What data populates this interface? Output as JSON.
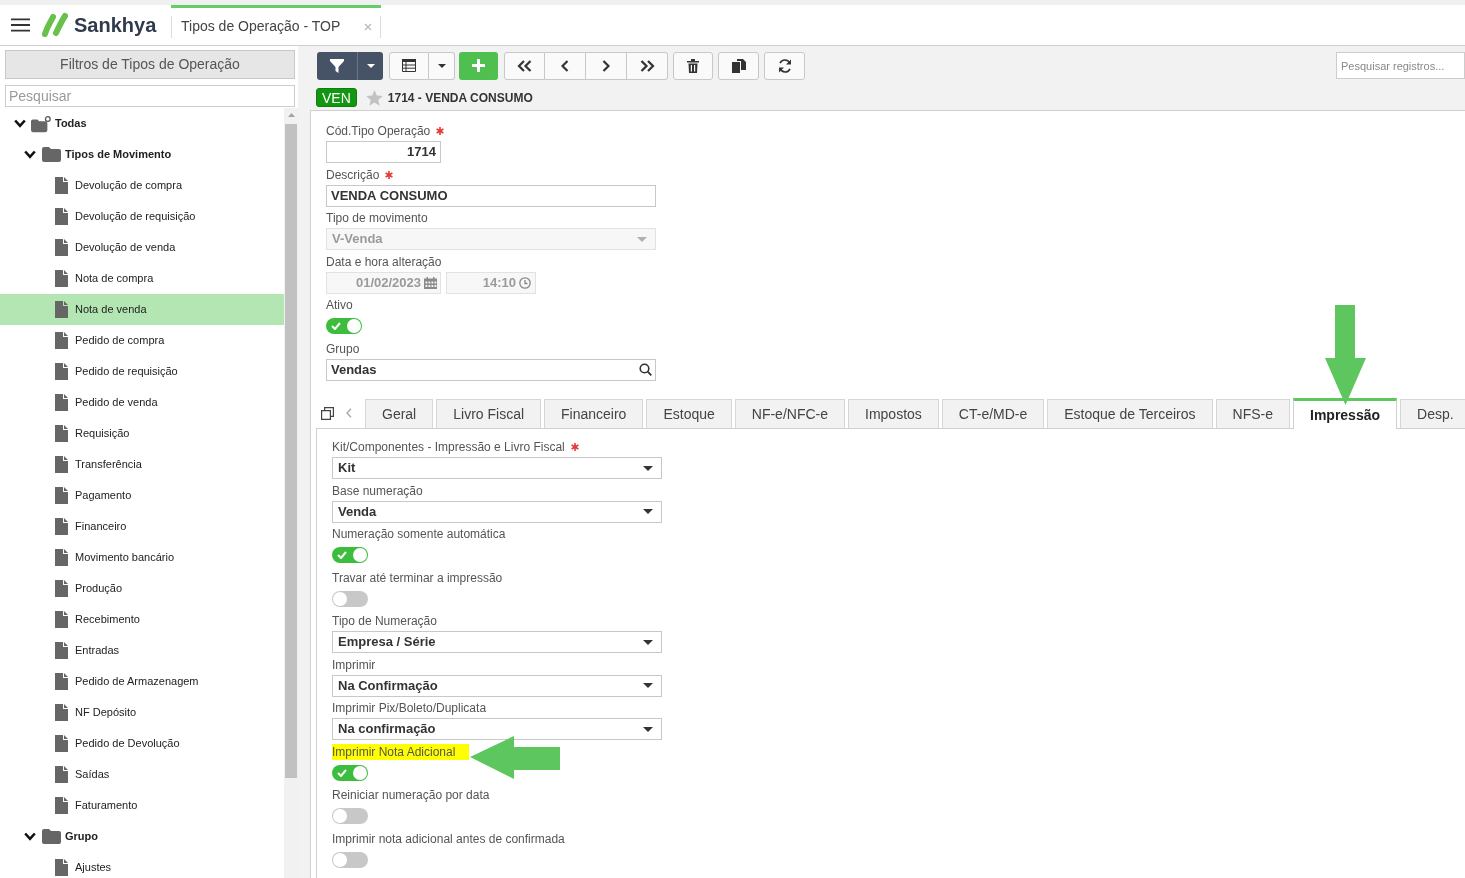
{
  "header": {
    "brand": "Sankhya",
    "tabs": [
      {
        "label": "Tipos de Operação - TOP",
        "selected": true
      }
    ]
  },
  "sidebar": {
    "filter_button": "Filtros de Tipos de Operação",
    "search": {
      "placeholder": "Pesquisar"
    },
    "tree": [
      {
        "label": "Todas",
        "kind": "root",
        "expanded": true,
        "selected": false,
        "children": [
          {
            "label": "Tipos de Movimento",
            "kind": "folder",
            "expanded": true,
            "selected": false,
            "children": [
              {
                "label": "Devolução de compra",
                "kind": "document",
                "selected": false
              },
              {
                "label": "Devolução de requisição",
                "kind": "document",
                "selected": false
              },
              {
                "label": "Devolução de venda",
                "kind": "document",
                "selected": false
              },
              {
                "label": "Nota de compra",
                "kind": "document",
                "selected": false
              },
              {
                "label": "Nota de venda",
                "kind": "document",
                "selected": true
              },
              {
                "label": "Pedido de compra",
                "kind": "document",
                "selected": false
              },
              {
                "label": "Pedido de requisição",
                "kind": "document",
                "selected": false
              },
              {
                "label": "Pedido de venda",
                "kind": "document",
                "selected": false
              },
              {
                "label": "Requisição",
                "kind": "document",
                "selected": false
              },
              {
                "label": "Transferência",
                "kind": "document",
                "selected": false
              },
              {
                "label": "Pagamento",
                "kind": "document",
                "selected": false
              },
              {
                "label": "Financeiro",
                "kind": "document",
                "selected": false
              },
              {
                "label": "Movimento bancário",
                "kind": "document",
                "selected": false
              },
              {
                "label": "Produção",
                "kind": "document",
                "selected": false
              },
              {
                "label": "Recebimento",
                "kind": "document",
                "selected": false
              },
              {
                "label": "Entradas",
                "kind": "document",
                "selected": false
              },
              {
                "label": "Pedido de Armazenagem",
                "kind": "document",
                "selected": false
              },
              {
                "label": "NF Depósito",
                "kind": "document",
                "selected": false
              },
              {
                "label": "Pedido de Devolução",
                "kind": "document",
                "selected": false
              },
              {
                "label": "Saídas",
                "kind": "document",
                "selected": false
              },
              {
                "label": "Faturamento",
                "kind": "document",
                "selected": false
              }
            ]
          },
          {
            "label": "Grupo",
            "kind": "folder",
            "expanded": true,
            "selected": false,
            "children": [
              {
                "label": "Ajustes",
                "kind": "document",
                "selected": false
              }
            ]
          }
        ]
      }
    ]
  },
  "toolbar": {
    "search": {
      "placeholder": "Pesquisar registros..."
    }
  },
  "record": {
    "badge": "VEN",
    "favorite": false,
    "title": "1714 - VENDA CONSUMO"
  },
  "form": {
    "fields": [
      {
        "kind": "number",
        "label": "Cód.Tipo Operação",
        "required": true,
        "disabled": false,
        "value": "1714"
      },
      {
        "kind": "text",
        "label": "Descrição",
        "required": true,
        "disabled": false,
        "value": "VENDA CONSUMO"
      },
      {
        "kind": "select",
        "label": "Tipo de movimento",
        "required": false,
        "disabled": true,
        "value": "V-Venda"
      },
      {
        "kind": "datetime",
        "label": "Data e hora alteração",
        "required": false,
        "disabled": true,
        "date": "01/02/2023",
        "time": "14:10"
      },
      {
        "kind": "toggle",
        "label": "Ativo",
        "required": false,
        "disabled": false,
        "on": true
      },
      {
        "kind": "lookup",
        "label": "Grupo",
        "required": false,
        "disabled": false,
        "value": "Vendas"
      }
    ]
  },
  "tabs": [
    {
      "label": "Geral",
      "selected": false
    },
    {
      "label": "Livro Fiscal",
      "selected": false
    },
    {
      "label": "Financeiro",
      "selected": false
    },
    {
      "label": "Estoque",
      "selected": false
    },
    {
      "label": "NF-e/NFC-e",
      "selected": false
    },
    {
      "label": "Impostos",
      "selected": false
    },
    {
      "label": "CT-e/MD-e",
      "selected": false
    },
    {
      "label": "Estoque de Terceiros",
      "selected": false
    },
    {
      "label": "NFS-e",
      "selected": false
    },
    {
      "label": "Impressão",
      "selected": true
    },
    {
      "label": "Desp.",
      "selected": false
    }
  ],
  "tab_panel": {
    "fields": [
      {
        "kind": "select",
        "label": "Kit/Componentes - Impressão e Livro Fiscal",
        "required": true,
        "highlighted": false,
        "value": "Kit"
      },
      {
        "kind": "select",
        "label": "Base numeração",
        "required": false,
        "highlighted": false,
        "value": "Venda"
      },
      {
        "kind": "toggle",
        "label": "Numeração somente automática",
        "required": false,
        "highlighted": false,
        "on": true
      },
      {
        "kind": "toggle",
        "label": "Travar até terminar a impressão",
        "required": false,
        "highlighted": false,
        "on": false
      },
      {
        "kind": "select",
        "label": "Tipo de Numeração",
        "required": false,
        "highlighted": false,
        "value": "Empresa / Série"
      },
      {
        "kind": "select",
        "label": "Imprimir",
        "required": false,
        "highlighted": false,
        "value": "Na Confirmação"
      },
      {
        "kind": "select",
        "label": "Imprimir Pix/Boleto/Duplicata",
        "required": false,
        "highlighted": false,
        "value": "Na confirmação"
      },
      {
        "kind": "toggle",
        "label": "Imprimir Nota Adicional",
        "required": false,
        "highlighted": true,
        "on": true
      },
      {
        "kind": "toggle",
        "label": "Reiniciar numeração por data",
        "required": false,
        "highlighted": false,
        "on": false
      },
      {
        "kind": "toggle",
        "label": "Imprimir nota adicional antes de confirmada",
        "required": false,
        "highlighted": false,
        "on": false
      }
    ]
  }
}
